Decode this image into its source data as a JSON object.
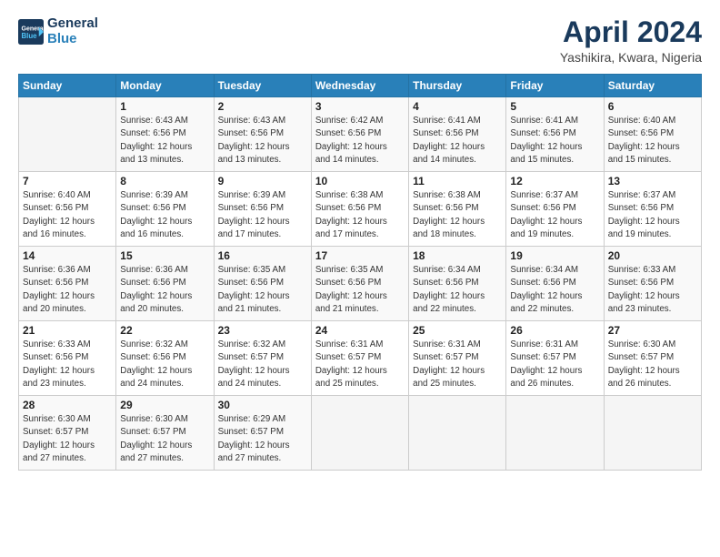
{
  "header": {
    "logo_line1": "General",
    "logo_line2": "Blue",
    "month_title": "April 2024",
    "subtitle": "Yashikira, Kwara, Nigeria"
  },
  "weekdays": [
    "Sunday",
    "Monday",
    "Tuesday",
    "Wednesday",
    "Thursday",
    "Friday",
    "Saturday"
  ],
  "weeks": [
    [
      {
        "day": "",
        "detail": ""
      },
      {
        "day": "1",
        "detail": "Sunrise: 6:43 AM\nSunset: 6:56 PM\nDaylight: 12 hours\nand 13 minutes."
      },
      {
        "day": "2",
        "detail": "Sunrise: 6:43 AM\nSunset: 6:56 PM\nDaylight: 12 hours\nand 13 minutes."
      },
      {
        "day": "3",
        "detail": "Sunrise: 6:42 AM\nSunset: 6:56 PM\nDaylight: 12 hours\nand 14 minutes."
      },
      {
        "day": "4",
        "detail": "Sunrise: 6:41 AM\nSunset: 6:56 PM\nDaylight: 12 hours\nand 14 minutes."
      },
      {
        "day": "5",
        "detail": "Sunrise: 6:41 AM\nSunset: 6:56 PM\nDaylight: 12 hours\nand 15 minutes."
      },
      {
        "day": "6",
        "detail": "Sunrise: 6:40 AM\nSunset: 6:56 PM\nDaylight: 12 hours\nand 15 minutes."
      }
    ],
    [
      {
        "day": "7",
        "detail": "Sunrise: 6:40 AM\nSunset: 6:56 PM\nDaylight: 12 hours\nand 16 minutes."
      },
      {
        "day": "8",
        "detail": "Sunrise: 6:39 AM\nSunset: 6:56 PM\nDaylight: 12 hours\nand 16 minutes."
      },
      {
        "day": "9",
        "detail": "Sunrise: 6:39 AM\nSunset: 6:56 PM\nDaylight: 12 hours\nand 17 minutes."
      },
      {
        "day": "10",
        "detail": "Sunrise: 6:38 AM\nSunset: 6:56 PM\nDaylight: 12 hours\nand 17 minutes."
      },
      {
        "day": "11",
        "detail": "Sunrise: 6:38 AM\nSunset: 6:56 PM\nDaylight: 12 hours\nand 18 minutes."
      },
      {
        "day": "12",
        "detail": "Sunrise: 6:37 AM\nSunset: 6:56 PM\nDaylight: 12 hours\nand 19 minutes."
      },
      {
        "day": "13",
        "detail": "Sunrise: 6:37 AM\nSunset: 6:56 PM\nDaylight: 12 hours\nand 19 minutes."
      }
    ],
    [
      {
        "day": "14",
        "detail": "Sunrise: 6:36 AM\nSunset: 6:56 PM\nDaylight: 12 hours\nand 20 minutes."
      },
      {
        "day": "15",
        "detail": "Sunrise: 6:36 AM\nSunset: 6:56 PM\nDaylight: 12 hours\nand 20 minutes."
      },
      {
        "day": "16",
        "detail": "Sunrise: 6:35 AM\nSunset: 6:56 PM\nDaylight: 12 hours\nand 21 minutes."
      },
      {
        "day": "17",
        "detail": "Sunrise: 6:35 AM\nSunset: 6:56 PM\nDaylight: 12 hours\nand 21 minutes."
      },
      {
        "day": "18",
        "detail": "Sunrise: 6:34 AM\nSunset: 6:56 PM\nDaylight: 12 hours\nand 22 minutes."
      },
      {
        "day": "19",
        "detail": "Sunrise: 6:34 AM\nSunset: 6:56 PM\nDaylight: 12 hours\nand 22 minutes."
      },
      {
        "day": "20",
        "detail": "Sunrise: 6:33 AM\nSunset: 6:56 PM\nDaylight: 12 hours\nand 23 minutes."
      }
    ],
    [
      {
        "day": "21",
        "detail": "Sunrise: 6:33 AM\nSunset: 6:56 PM\nDaylight: 12 hours\nand 23 minutes."
      },
      {
        "day": "22",
        "detail": "Sunrise: 6:32 AM\nSunset: 6:56 PM\nDaylight: 12 hours\nand 24 minutes."
      },
      {
        "day": "23",
        "detail": "Sunrise: 6:32 AM\nSunset: 6:57 PM\nDaylight: 12 hours\nand 24 minutes."
      },
      {
        "day": "24",
        "detail": "Sunrise: 6:31 AM\nSunset: 6:57 PM\nDaylight: 12 hours\nand 25 minutes."
      },
      {
        "day": "25",
        "detail": "Sunrise: 6:31 AM\nSunset: 6:57 PM\nDaylight: 12 hours\nand 25 minutes."
      },
      {
        "day": "26",
        "detail": "Sunrise: 6:31 AM\nSunset: 6:57 PM\nDaylight: 12 hours\nand 26 minutes."
      },
      {
        "day": "27",
        "detail": "Sunrise: 6:30 AM\nSunset: 6:57 PM\nDaylight: 12 hours\nand 26 minutes."
      }
    ],
    [
      {
        "day": "28",
        "detail": "Sunrise: 6:30 AM\nSunset: 6:57 PM\nDaylight: 12 hours\nand 27 minutes."
      },
      {
        "day": "29",
        "detail": "Sunrise: 6:30 AM\nSunset: 6:57 PM\nDaylight: 12 hours\nand 27 minutes."
      },
      {
        "day": "30",
        "detail": "Sunrise: 6:29 AM\nSunset: 6:57 PM\nDaylight: 12 hours\nand 27 minutes."
      },
      {
        "day": "",
        "detail": ""
      },
      {
        "day": "",
        "detail": ""
      },
      {
        "day": "",
        "detail": ""
      },
      {
        "day": "",
        "detail": ""
      }
    ]
  ]
}
